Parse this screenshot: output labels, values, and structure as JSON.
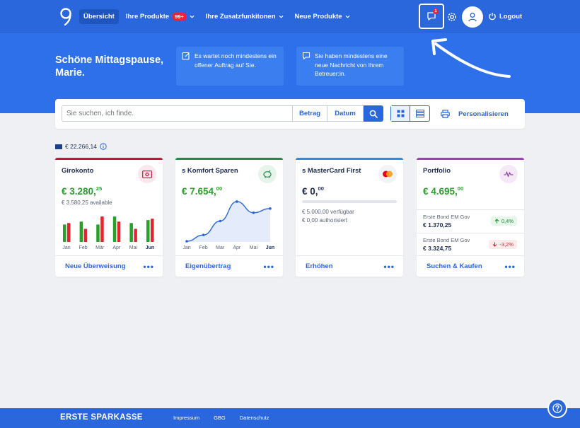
{
  "nav": {
    "items": [
      {
        "label": "Übersicht",
        "active": true
      },
      {
        "label": "Ihre Produkte",
        "badge": "99+",
        "dropdown": true
      },
      {
        "label": "Ihre Zusatzfunkitonen",
        "dropdown": true
      },
      {
        "label": "Neue Produkte",
        "dropdown": true
      }
    ],
    "message_count": "1",
    "logout_label": "Logout"
  },
  "hero": {
    "greeting": "Schöne Mittagspause, Marie.",
    "notices": [
      {
        "icon": "edit-icon",
        "text": "Es wartet noch mindestens ein offener Auftrag auf Sie."
      },
      {
        "icon": "chat-icon",
        "text": "Sie haben mindestens eine neue Nachricht von Ihrem Betreuer:in."
      }
    ]
  },
  "search": {
    "placeholder": "Sie suchen, ich finde.",
    "amount_label": "Betrag",
    "date_label": "Datum",
    "personalize_label": "Personalisieren"
  },
  "total_balance": "€ 22.266,14",
  "cards": {
    "giro": {
      "title": "Girokonto",
      "amount_main": "€ 3.280,",
      "amount_cents": "25",
      "available": "€ 3.580,25 available",
      "months": [
        "Jan",
        "Feb",
        "Mär",
        "Apr",
        "Mai",
        "Jun"
      ],
      "footer_link": "Neue Überweisung"
    },
    "sparen": {
      "title": "s Komfort Sparen",
      "amount_main": "€ 7.654,",
      "amount_cents": "00",
      "months": [
        "Jan",
        "Feb",
        "Mar",
        "Apr",
        "Mai",
        "Jun"
      ],
      "footer_link": "Eigenübertrag"
    },
    "master": {
      "title": "s MasterCard First",
      "amount_main": "€ 0,",
      "amount_cents": "00",
      "limit": "€ 5.000,00 verfügbar",
      "authorized": "€ 0,00 authorisiert",
      "footer_link": "Erhöhen"
    },
    "portfolio": {
      "title": "Portfolio",
      "amount_main": "€ 4.695,",
      "amount_cents": "00",
      "holdings": [
        {
          "name": "Erste Bond EM Gov",
          "value": "€ 1.370,25",
          "change": "0,4%",
          "direction": "up"
        },
        {
          "name": "Erste Bond EM Gov",
          "value": "€ 3.324,75",
          "change": "-3,2%",
          "direction": "down"
        }
      ],
      "footer_link": "Suchen & Kaufen"
    }
  },
  "footer": {
    "brand": "ERSTE SPARKASSE",
    "links": [
      "Impressum",
      "GBG",
      "Datenschutz"
    ]
  },
  "colors": {
    "primary": "#2a67dc",
    "hero": "#2e70ea",
    "positive": "#2aa02a",
    "negative": "#e6263a",
    "bar_green": "#2aa02a",
    "bar_red": "#e0262e"
  },
  "chart_data": [
    {
      "type": "bar",
      "categories": [
        "Jan",
        "Feb",
        "Mär",
        "Apr",
        "Mai",
        "Jun"
      ],
      "series": [
        {
          "values": [
            24,
            28,
            24,
            35,
            26,
            30
          ]
        },
        {
          "values": [
            26,
            18,
            35,
            28,
            18,
            32
          ]
        }
      ]
    },
    {
      "type": "area",
      "categories": [
        "Jan",
        "Feb",
        "Mar",
        "Apr",
        "Mai",
        "Jun"
      ],
      "values": [
        1,
        10,
        30,
        58,
        42,
        48
      ]
    }
  ]
}
